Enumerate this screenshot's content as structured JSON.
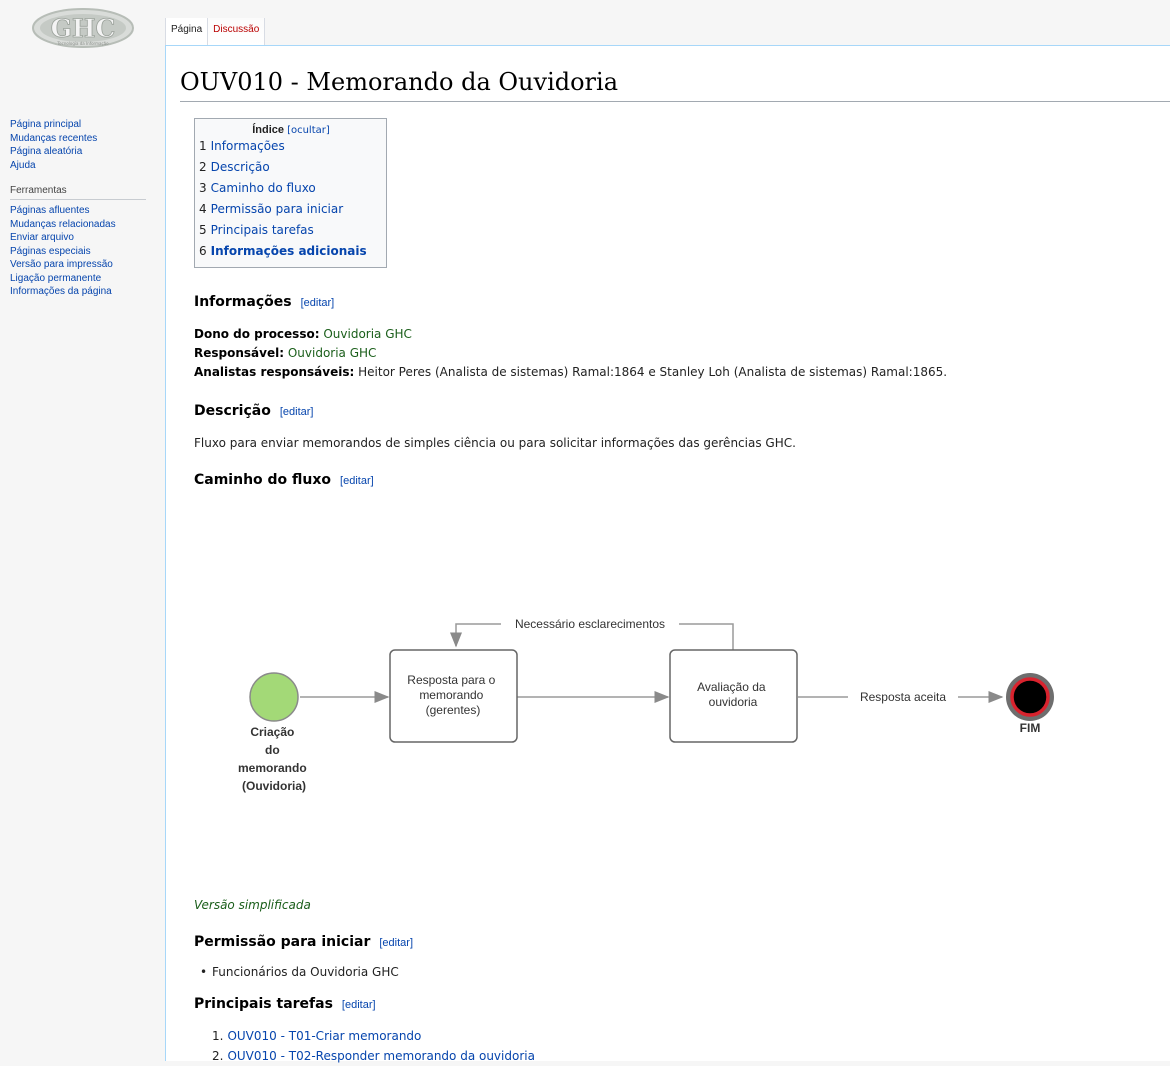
{
  "logo": {
    "text": "GHC",
    "subtitle": "Tecnologia da Informação"
  },
  "sidebar": {
    "nav": [
      {
        "label": "Página principal"
      },
      {
        "label": "Mudanças recentes"
      },
      {
        "label": "Página aleatória"
      },
      {
        "label": "Ajuda"
      }
    ],
    "tools_heading": "Ferramentas",
    "tools": [
      {
        "label": "Páginas afluentes"
      },
      {
        "label": "Mudanças relacionadas"
      },
      {
        "label": "Enviar arquivo"
      },
      {
        "label": "Páginas especiais"
      },
      {
        "label": "Versão para impressão"
      },
      {
        "label": "Ligação permanente"
      },
      {
        "label": "Informações da página"
      }
    ]
  },
  "tabs": [
    {
      "label": "Página",
      "state": "selected"
    },
    {
      "label": "Discussão",
      "state": "new"
    }
  ],
  "page_title": "OUV010 - Memorando da Ouvidoria",
  "toc": {
    "title": "Índice",
    "toggle": "[ocultar]",
    "items": [
      {
        "num": "1",
        "label": "Informações"
      },
      {
        "num": "2",
        "label": "Descrição"
      },
      {
        "num": "3",
        "label": "Caminho do fluxo"
      },
      {
        "num": "4",
        "label": "Permissão para iniciar"
      },
      {
        "num": "5",
        "label": "Principais tarefas"
      },
      {
        "num": "6",
        "label": "Informações adicionais"
      }
    ]
  },
  "edit_label": "[editar]",
  "informacoes": {
    "heading": "Informações",
    "dono_label": "Dono do processo:",
    "dono_value": "Ouvidoria GHC",
    "resp_label": "Responsável:",
    "resp_value": "Ouvidoria GHC",
    "analistas_label": "Analistas responsáveis:",
    "analistas_value": "Heitor Peres (Analista de sistemas) Ramal:1864 e Stanley Loh (Analista de sistemas) Ramal:1865."
  },
  "descricao": {
    "heading": "Descrição",
    "text": "Fluxo para enviar memorandos de simples ciência ou para solicitar informações das gerências GHC."
  },
  "caminho": {
    "heading": "Caminho do fluxo",
    "diagram": {
      "start_label": [
        "Criação",
        "do",
        "memorando",
        "(Ouvidoria)"
      ],
      "box1": [
        "Resposta para o",
        "memorando",
        "(gerentes)"
      ],
      "box2": [
        "Avaliação da",
        "ouvidoria"
      ],
      "loop_label": "Necessário esclarecimentos",
      "accept_label": "Resposta aceita",
      "end_label": "FIM",
      "colors": {
        "start": "#a3d977",
        "end_ring": "#d9232e",
        "end_outer": "#6e6e6e"
      }
    },
    "caption": "Versão simplificada"
  },
  "permissao": {
    "heading": "Permissão para iniciar",
    "items": [
      "Funcionários da Ouvidoria GHC"
    ]
  },
  "tarefas": {
    "heading": "Principais tarefas",
    "items": [
      {
        "num": "1.",
        "label": "OUV010 - T01-Criar memorando"
      },
      {
        "num": "2.",
        "label": "OUV010 - T02-Responder memorando da ouvidoria"
      }
    ]
  }
}
